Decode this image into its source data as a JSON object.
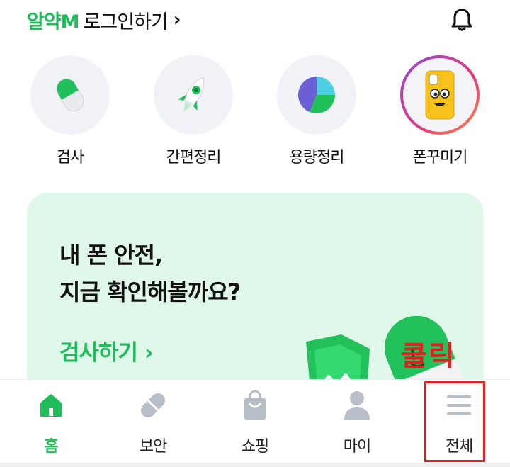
{
  "header": {
    "brand": "알약M",
    "login_text": "로그인하기",
    "chevron": "›"
  },
  "quick_menu": [
    {
      "label": "검사",
      "icon": "pill-icon"
    },
    {
      "label": "간편정리",
      "icon": "rocket-icon"
    },
    {
      "label": "용량정리",
      "icon": "pie-chart-icon"
    },
    {
      "label": "폰꾸미기",
      "icon": "phone-case-icon"
    }
  ],
  "promo": {
    "title_line1": "내 폰 안전,",
    "title_line2": "지금 확인해볼까요?",
    "cta": "검사하기 ›"
  },
  "annotation": {
    "click_text": "클릭"
  },
  "tabbar": [
    {
      "label": "홈",
      "icon": "home-icon",
      "active": true
    },
    {
      "label": "보안",
      "icon": "pill-icon",
      "active": false
    },
    {
      "label": "쇼핑",
      "icon": "shopping-bag-icon",
      "active": false
    },
    {
      "label": "마이",
      "icon": "person-icon",
      "active": false
    },
    {
      "label": "전체",
      "icon": "menu-icon",
      "active": false
    }
  ],
  "colors": {
    "accent": "#1ebd5a",
    "card_bg": "#dff8e9",
    "highlight": "#e0201f"
  }
}
